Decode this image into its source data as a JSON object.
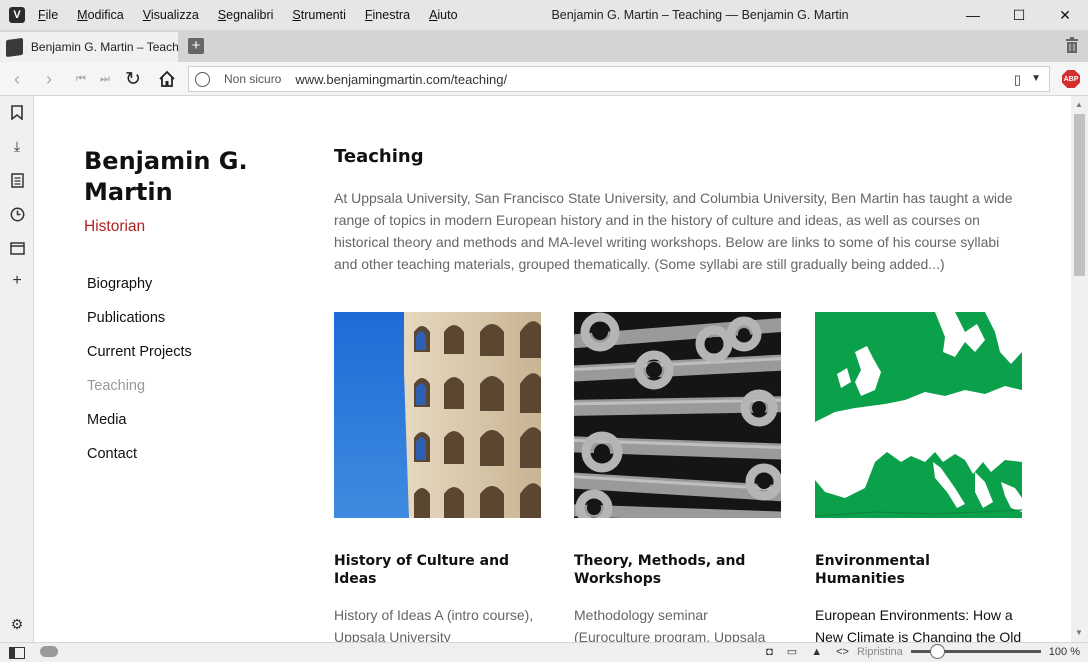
{
  "window": {
    "title": "Benjamin G. Martin – Teaching — Benjamin G. Martin",
    "menus": [
      "File",
      "Modifica",
      "Visualizza",
      "Segnalibri",
      "Strumenti",
      "Finestra",
      "Aiuto"
    ],
    "controls": {
      "minimize": "—",
      "maximize": "☐",
      "close": "✕"
    }
  },
  "tabs": [
    {
      "label": "Benjamin G. Martin – Teaching"
    }
  ],
  "address": {
    "security_label": "Non sicuro",
    "url": "www.benjamingmartin.com/teaching/"
  },
  "status": {
    "reset_label": "Ripristina",
    "zoom": "100 %"
  },
  "site": {
    "name": "Benjamin G. Martin",
    "tagline": "Historian",
    "nav": [
      {
        "label": "Biography",
        "active": false
      },
      {
        "label": "Publications",
        "active": false
      },
      {
        "label": "Current Projects",
        "active": false
      },
      {
        "label": "Teaching",
        "active": true
      },
      {
        "label": "Media",
        "active": false
      },
      {
        "label": "Contact",
        "active": false
      }
    ]
  },
  "main": {
    "title": "Teaching",
    "intro": "At Uppsala University, San Francisco State University, and Columbia University, Ben Martin has taught a wide range of topics in modern European history and in the history of culture and ideas, as well as courses on historical theory and methods and MA-level writing workshops. Below are links to some of his course syllabi and other teaching materials, grouped thematically. (Some syllabi are still gradually being added...)",
    "cards": [
      {
        "heading": "History of Culture and Ideas",
        "text": "History of Ideas A (intro course), Uppsala University"
      },
      {
        "heading": "Theory, Methods, and Workshops",
        "text": "Methodology seminar (Euroculture program, Uppsala"
      },
      {
        "heading": "Environmental Humanities",
        "text": "European Environments: How a New Climate is Changing the Old World (Euroculture"
      }
    ]
  },
  "colors": {
    "accent": "#b22222",
    "map_green": "#0aa14a",
    "sky_blue": "#1f6fcf"
  }
}
